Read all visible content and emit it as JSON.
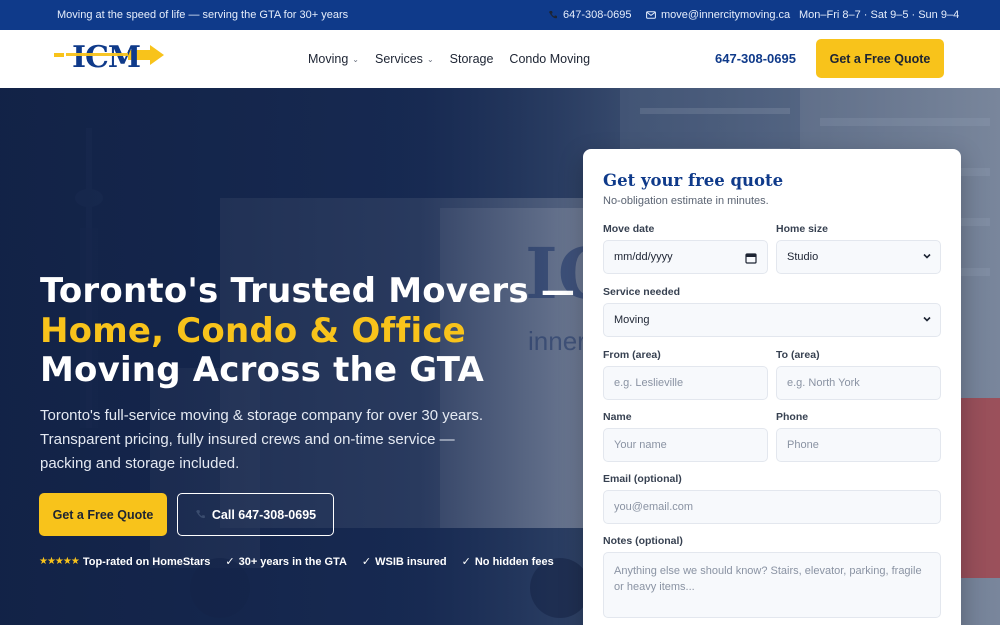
{
  "topbar": {
    "tagline": "Moving at the speed of life — serving the GTA for 30+ years",
    "phone": "647-308-0695",
    "email": "move@innercitymoving.ca",
    "hours": "Mon–Fri 8–7 · Sat 9–5 · Sun 9–4"
  },
  "header": {
    "logo_text": "ICM",
    "nav": [
      {
        "label": "Moving",
        "has_dropdown": true
      },
      {
        "label": "Services",
        "has_dropdown": true
      },
      {
        "label": "Storage",
        "has_dropdown": false
      },
      {
        "label": "Condo Moving",
        "has_dropdown": false
      }
    ],
    "phone": "647-308-0695",
    "cta_label": "Get a Free Quote"
  },
  "hero": {
    "title_line1": "Toronto's Trusted Movers —",
    "title_line2": "Home, Condo & Office",
    "title_line3": "Moving Across the GTA",
    "subtitle": "Toronto's full-service moving & storage company for over 30 years. Transparent pricing, fully insured crews and on-time service — packing and storage included.",
    "primary_cta": "Get a Free Quote",
    "secondary_cta": "Call 647-308-0695",
    "badges": [
      {
        "prefix": "★★★★★",
        "text": "Top-rated on HomeStars"
      },
      {
        "prefix": "✓",
        "text": "30+ years in the GTA"
      },
      {
        "prefix": "✓",
        "text": "WSIB insured"
      },
      {
        "prefix": "✓",
        "text": "No hidden fees"
      }
    ]
  },
  "quote_form": {
    "title": "Get your free quote",
    "subtitle": "No-obligation estimate in minutes.",
    "move_date": {
      "label": "Move date",
      "placeholder": "mm/dd/yyyy"
    },
    "home_size": {
      "label": "Home size",
      "value": "Studio"
    },
    "service": {
      "label": "Service needed",
      "value": "Moving"
    },
    "from": {
      "label": "From (area)",
      "placeholder": "e.g. Leslieville"
    },
    "to": {
      "label": "To (area)",
      "placeholder": "e.g. North York"
    },
    "name": {
      "label": "Name",
      "placeholder": "Your name"
    },
    "phone": {
      "label": "Phone",
      "placeholder": "Phone"
    },
    "email": {
      "label": "Email (optional)",
      "placeholder": "you@email.com"
    },
    "notes": {
      "label": "Notes (optional)",
      "placeholder": "Anything else we should know? Stairs, elevator, parking, fragile or heavy items..."
    }
  },
  "colors": {
    "brand_blue": "#0f3a8a",
    "accent_yellow": "#f8c31b"
  }
}
